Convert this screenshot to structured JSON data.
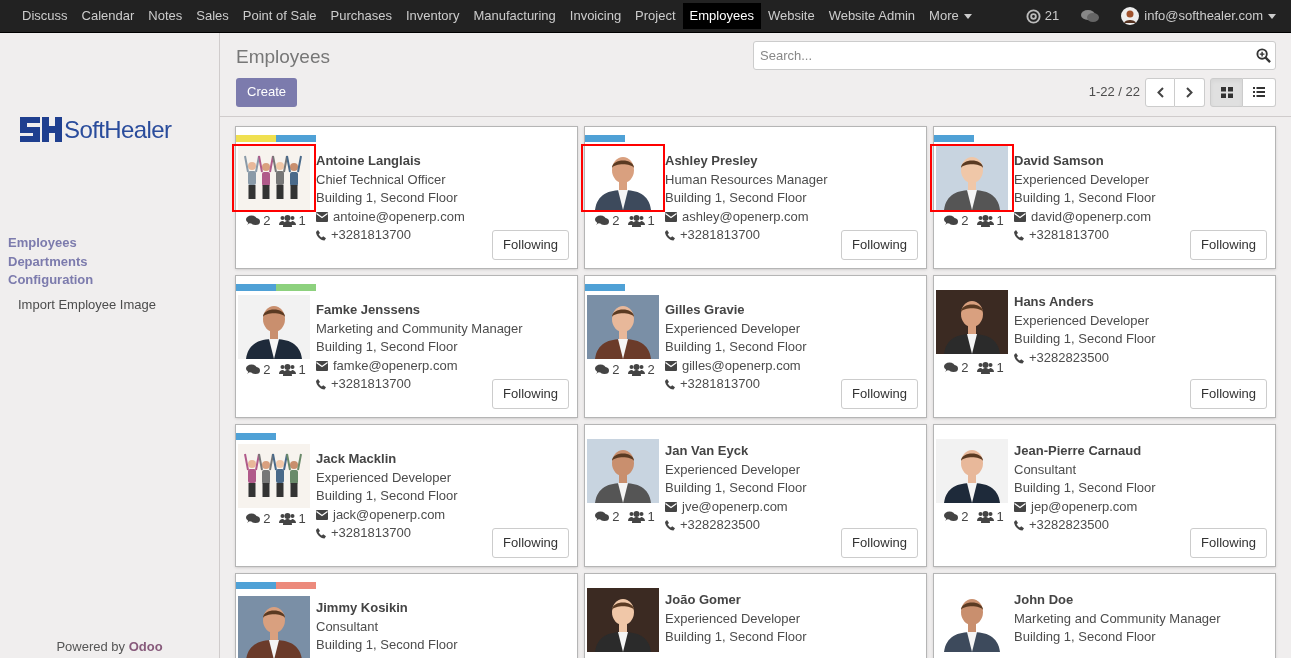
{
  "top_menu": [
    {
      "label": "Discuss",
      "selected": false
    },
    {
      "label": "Calendar",
      "selected": false
    },
    {
      "label": "Notes",
      "selected": false
    },
    {
      "label": "Sales",
      "selected": false
    },
    {
      "label": "Point of Sale",
      "selected": false
    },
    {
      "label": "Purchases",
      "selected": false
    },
    {
      "label": "Inventory",
      "selected": false
    },
    {
      "label": "Manufacturing",
      "selected": false
    },
    {
      "label": "Invoicing",
      "selected": false
    },
    {
      "label": "Project",
      "selected": false
    },
    {
      "label": "Employees",
      "selected": true
    },
    {
      "label": "Website",
      "selected": false
    },
    {
      "label": "Website Admin",
      "selected": false
    },
    {
      "label": "More",
      "selected": false
    }
  ],
  "mentions_count": "21",
  "user": "info@softhealer.com",
  "sidebar": {
    "logo": "SoftHealer",
    "items": [
      {
        "label": "Employees",
        "kind": "section"
      },
      {
        "label": "Departments",
        "kind": "section"
      },
      {
        "label": "Configuration",
        "kind": "section"
      },
      {
        "label": "Import Employee Image",
        "kind": "entry"
      }
    ],
    "footer": "Powered by **Odoo**"
  },
  "page_title": "Employees",
  "search": {
    "placeholder": "Search..."
  },
  "create_button": "Create",
  "pager": "1-22 / 22",
  "view_modes": [
    {
      "kind": "kanban",
      "selected": true
    },
    {
      "kind": "list",
      "selected": false
    }
  ],
  "employees": [
    {
      "name": "Antoine Langlais",
      "job": "Chief Technical Officer",
      "location": "Building 1, Second Floor",
      "email": "antoine@openerp.com",
      "phone": "+3281813700",
      "messages": "2",
      "followers": "1",
      "follow_button": "Following",
      "tags": [
        {
          "color": "#f0e050"
        },
        {
          "color": "#4fa1d6"
        }
      ],
      "highlighted": true
    },
    {
      "name": "Ashley Presley",
      "job": "Human Resources Manager",
      "location": "Building 1, Second Floor",
      "email": "ashley@openerp.com",
      "phone": "+3281813700",
      "messages": "2",
      "followers": "1",
      "follow_button": "Following",
      "tags": [
        {
          "color": "#4fa1d6"
        }
      ],
      "highlighted": true
    },
    {
      "name": "David Samson",
      "job": "Experienced Developer",
      "location": "Building 1, Second Floor",
      "email": "david@openerp.com",
      "phone": "+3281813700",
      "messages": "2",
      "followers": "1",
      "follow_button": "Following",
      "tags": [
        {
          "color": "#4fa1d6"
        }
      ],
      "highlighted": true
    },
    {
      "name": "Famke Jenssens",
      "job": "Marketing and Community Manager",
      "location": "Building 1, Second Floor",
      "email": "famke@openerp.com",
      "phone": "+3281813700",
      "messages": "2",
      "followers": "1",
      "follow_button": "Following",
      "tags": [
        {
          "color": "#4fa1d6"
        },
        {
          "color": "#8dd17e"
        }
      ],
      "highlighted": false
    },
    {
      "name": "Gilles Gravie",
      "job": "Experienced Developer",
      "location": "Building 1, Second Floor",
      "email": "gilles@openerp.com",
      "phone": "+3281813700",
      "messages": "2",
      "followers": "2",
      "follow_button": "Following",
      "tags": [
        {
          "color": "#4fa1d6"
        }
      ],
      "highlighted": false
    },
    {
      "name": "Hans Anders",
      "job": "Experienced Developer",
      "location": "Building 1, Second Floor",
      "phone": "+3282823500",
      "messages": "2",
      "followers": "1",
      "follow_button": "Following",
      "highlighted": false
    },
    {
      "name": "Jack Macklin",
      "job": "Experienced Developer",
      "location": "Building 1, Second Floor",
      "email": "jack@openerp.com",
      "phone": "+3281813700",
      "messages": "2",
      "followers": "1",
      "follow_button": "Following",
      "tags": [
        {
          "color": "#4fa1d6"
        }
      ],
      "highlighted": false
    },
    {
      "name": "Jan Van Eyck",
      "job": "Experienced Developer",
      "location": "Building 1, Second Floor",
      "email": "jve@openerp.com",
      "phone": "+3282823500",
      "messages": "2",
      "followers": "1",
      "follow_button": "Following",
      "highlighted": false
    },
    {
      "name": "Jean-Pierre Carnaud",
      "job": "Consultant",
      "location": "Building 1, Second Floor",
      "email": "jep@openerp.com",
      "phone": "+3282823500",
      "messages": "2",
      "followers": "1",
      "follow_button": "Following",
      "highlighted": false
    },
    {
      "name": "Jimmy Kosikin",
      "job": "Consultant",
      "location": "Building 1, Second Floor",
      "tags": [
        {
          "color": "#4fa1d6"
        },
        {
          "color": "#ec8a7c"
        }
      ],
      "highlighted": false
    },
    {
      "name": "João Gomer",
      "job": "Experienced Developer",
      "location": "Building 1, Second Floor",
      "highlighted": false
    },
    {
      "name": "John Doe",
      "job": "Marketing and Community Manager",
      "location": "Building 1, Second Floor",
      "highlighted": false
    }
  ]
}
